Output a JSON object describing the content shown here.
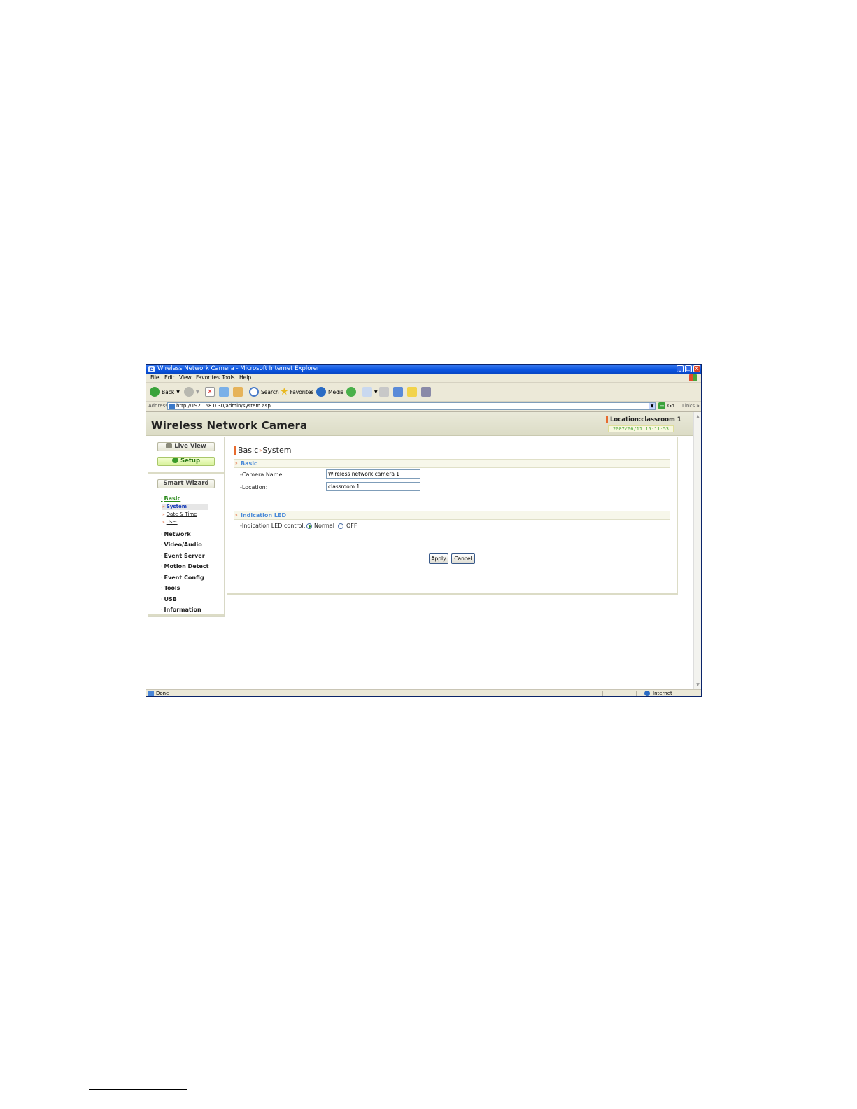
{
  "browser": {
    "title": "Wireless Network Camera - Microsoft Internet Explorer",
    "menu": [
      "File",
      "Edit",
      "View",
      "Favorites",
      "Tools",
      "Help"
    ],
    "toolbar": {
      "back": "Back",
      "search": "Search",
      "favorites": "Favorites",
      "media": "Media"
    },
    "address_label": "Address",
    "url": "http://192.168.0.30/admin/system.asp",
    "go": "Go",
    "links": "Links",
    "status": "Done",
    "zone": "Internet"
  },
  "camera": {
    "title": "Wireless Network Camera",
    "location_label": "Location:classroom 1",
    "datetime": "2007/06/11 15:11:53"
  },
  "sidebar": {
    "live_view": "Live View",
    "setup": "Setup",
    "smart_wizard": "Smart Wizard",
    "basic": "Basic",
    "sub": [
      "System",
      "Date & Time",
      "User"
    ],
    "nav": [
      "Network",
      "Video/Audio",
      "Event Server",
      "Motion Detect",
      "Event Config",
      "Tools",
      "USB",
      "Information"
    ]
  },
  "main": {
    "title_a": "Basic",
    "title_b": "System",
    "section_basic": "Basic",
    "camera_name_label": "-Camera Name:",
    "camera_name_value": "Wireless network camera 1",
    "location_label": "-Location:",
    "location_value": "classroom 1",
    "section_led": "Indication LED",
    "led_label": "-Indication LED control:",
    "led_normal": "Normal",
    "led_off": "OFF",
    "led_selected": "Normal",
    "apply": "Apply",
    "cancel": "Cancel"
  }
}
